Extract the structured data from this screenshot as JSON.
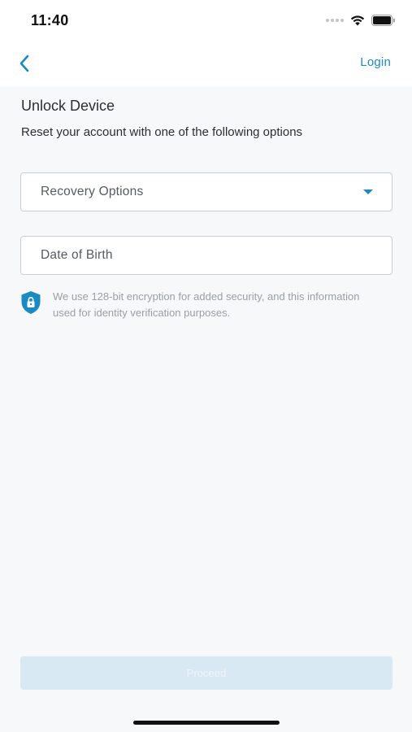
{
  "status_bar": {
    "time": "11:40"
  },
  "nav": {
    "back_icon": "chevron-left-icon",
    "login_label": "Login",
    "accent_color": "#1a8ac4"
  },
  "content": {
    "title": "Unlock Device",
    "subtitle": "Reset your account with one of the following options",
    "recovery_select": {
      "label": "Recovery Options",
      "icon": "caret-down-icon"
    },
    "dob_field": {
      "label": "Date of Birth"
    },
    "security_note": {
      "icon": "shield-lock-icon",
      "text": "We use 128-bit encryption for added security, and this information used for identity verification purposes."
    }
  },
  "footer": {
    "proceed_label": "Proceed",
    "proceed_disabled": true
  }
}
